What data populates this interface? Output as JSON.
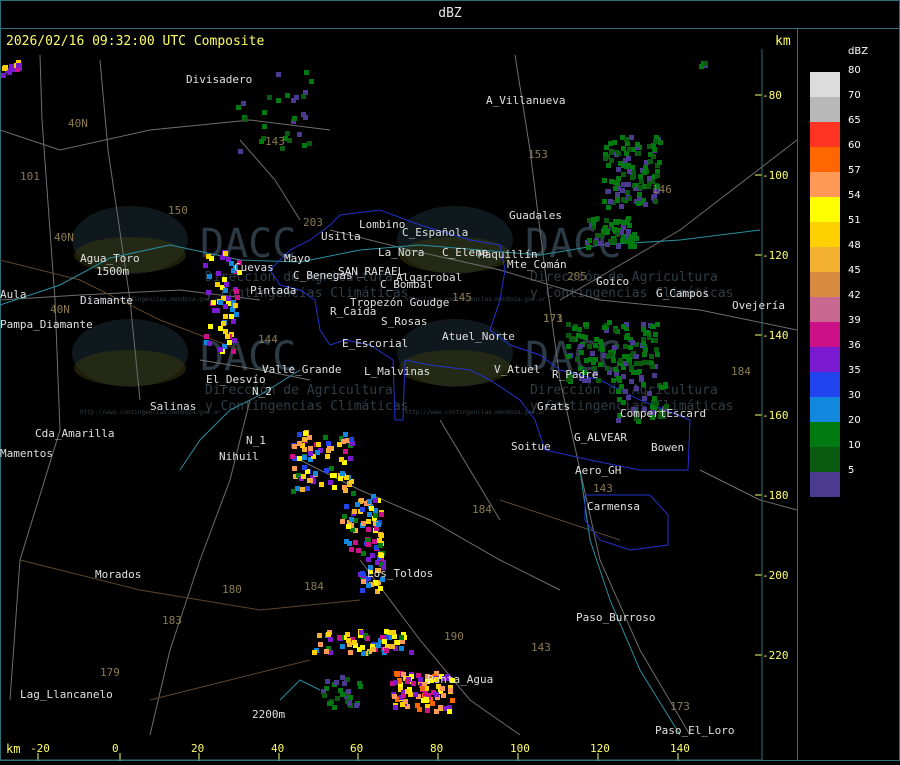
{
  "header": {
    "title": "dBZ"
  },
  "map": {
    "timestamp": "2026/02/16 09:32:00 UTC Composite",
    "km_label_top": "km",
    "km_label_bottom": "km",
    "x_ticks": [
      "-20",
      "0",
      "20",
      "40",
      "60",
      "80",
      "100",
      "120",
      "140"
    ],
    "y_ticks": [
      "-80",
      "-100",
      "-120",
      "-140",
      "-160",
      "-180",
      "-200",
      "-220"
    ],
    "places": [
      "Divisadero",
      "A_Villanueva",
      "Guadales",
      "C_Española",
      "C_Elena",
      "Maquillín",
      "Mte_Comán",
      "Goico",
      "G_Campos",
      "Ovejería",
      "Agua_Toro",
      "Pampa_Diamante",
      "Aula",
      "Pintada",
      "Cuevas",
      "La_Nora",
      "C_Benegas",
      "SAN_RAFAEL",
      "Algarrobal",
      "C_Bombal",
      "Tropezón Goudge",
      "R_Caída",
      "S_Rosas",
      "Atuel_Norte",
      "E_Escorial",
      "El_Desvío",
      "Valle_Grande",
      "L_Malvinas",
      "V_Atuel",
      "R_Padre",
      "Salinas",
      "N_2",
      "Grats",
      "CompertEscard",
      "G_ALVEAR",
      "Bowen",
      "Soitue",
      "Cda_Amarilla",
      "N_1",
      "Nihuil",
      "Mamentos",
      "Aero_GH",
      "Carmensa",
      "Los_Toldos",
      "Morados",
      "Paso_Burroso",
      "Punta_Agua",
      "Lag_Llancanelo",
      "Paso_El_Loro",
      "Lombino",
      "Usilla",
      "Mayo",
      "Diamante",
      "2200m",
      "1500m"
    ],
    "route_numbers": [
      "40N",
      "40N",
      "40N",
      "101",
      "143",
      "153",
      "150",
      "145",
      "146",
      "144",
      "173",
      "171",
      "143",
      "184",
      "180",
      "184",
      "183",
      "179",
      "190",
      "143",
      "173",
      "203",
      "205",
      "184"
    ],
    "watermarks": [
      {
        "logo": "DACC",
        "line1": "Dirección de Agricultura",
        "line2": "y Contingencias Climáticas",
        "url": "http://www.contingencias.mendoza.gov.ar"
      },
      {
        "logo": "DACC",
        "line1": "Dirección de Agricultura",
        "line2": "y Contingencias Climáticas",
        "url": "http://www.contingencias.mendoza.gov.ar"
      },
      {
        "logo": "DACC",
        "line1": "Dirección de Agricultura",
        "line2": "y Contingencias Climáticas",
        "url": "http://www.contingencias.mendoza.gov.ar"
      },
      {
        "logo": "DACC",
        "line1": "Dirección de Agricultura",
        "line2": "y Contingencias Climáticas",
        "url": "http://www.contingencias.mendoza.gov.ar"
      }
    ],
    "colors": {
      "roads": "#6e6e6e",
      "rivers": "#2a8fa0",
      "departments": "#2233cc",
      "labels": "#e0e0e0",
      "route_numbers": "#8a7a50",
      "ticks": "#ffff66"
    }
  },
  "legend": {
    "title": "dBZ",
    "items": [
      {
        "value": "80",
        "color": "#dcdcdc"
      },
      {
        "value": "70",
        "color": "#b8b8b8"
      },
      {
        "value": "65",
        "color": "#ff3322"
      },
      {
        "value": "60",
        "color": "#ff6600"
      },
      {
        "value": "57",
        "color": "#ff9955"
      },
      {
        "value": "54",
        "color": "#ffff00"
      },
      {
        "value": "51",
        "color": "#ffd000"
      },
      {
        "value": "48",
        "color": "#f4b030"
      },
      {
        "value": "45",
        "color": "#d88a40"
      },
      {
        "value": "42",
        "color": "#c86890"
      },
      {
        "value": "39",
        "color": "#cc1188"
      },
      {
        "value": "36",
        "color": "#7a1ad0"
      },
      {
        "value": "35",
        "color": "#2244ee"
      },
      {
        "value": "30",
        "color": "#1188dd"
      },
      {
        "value": "20",
        "color": "#007a10"
      },
      {
        "value": "10",
        "color": "#0a5a10"
      },
      {
        "value": "5",
        "color": "#4a3a90"
      }
    ]
  }
}
